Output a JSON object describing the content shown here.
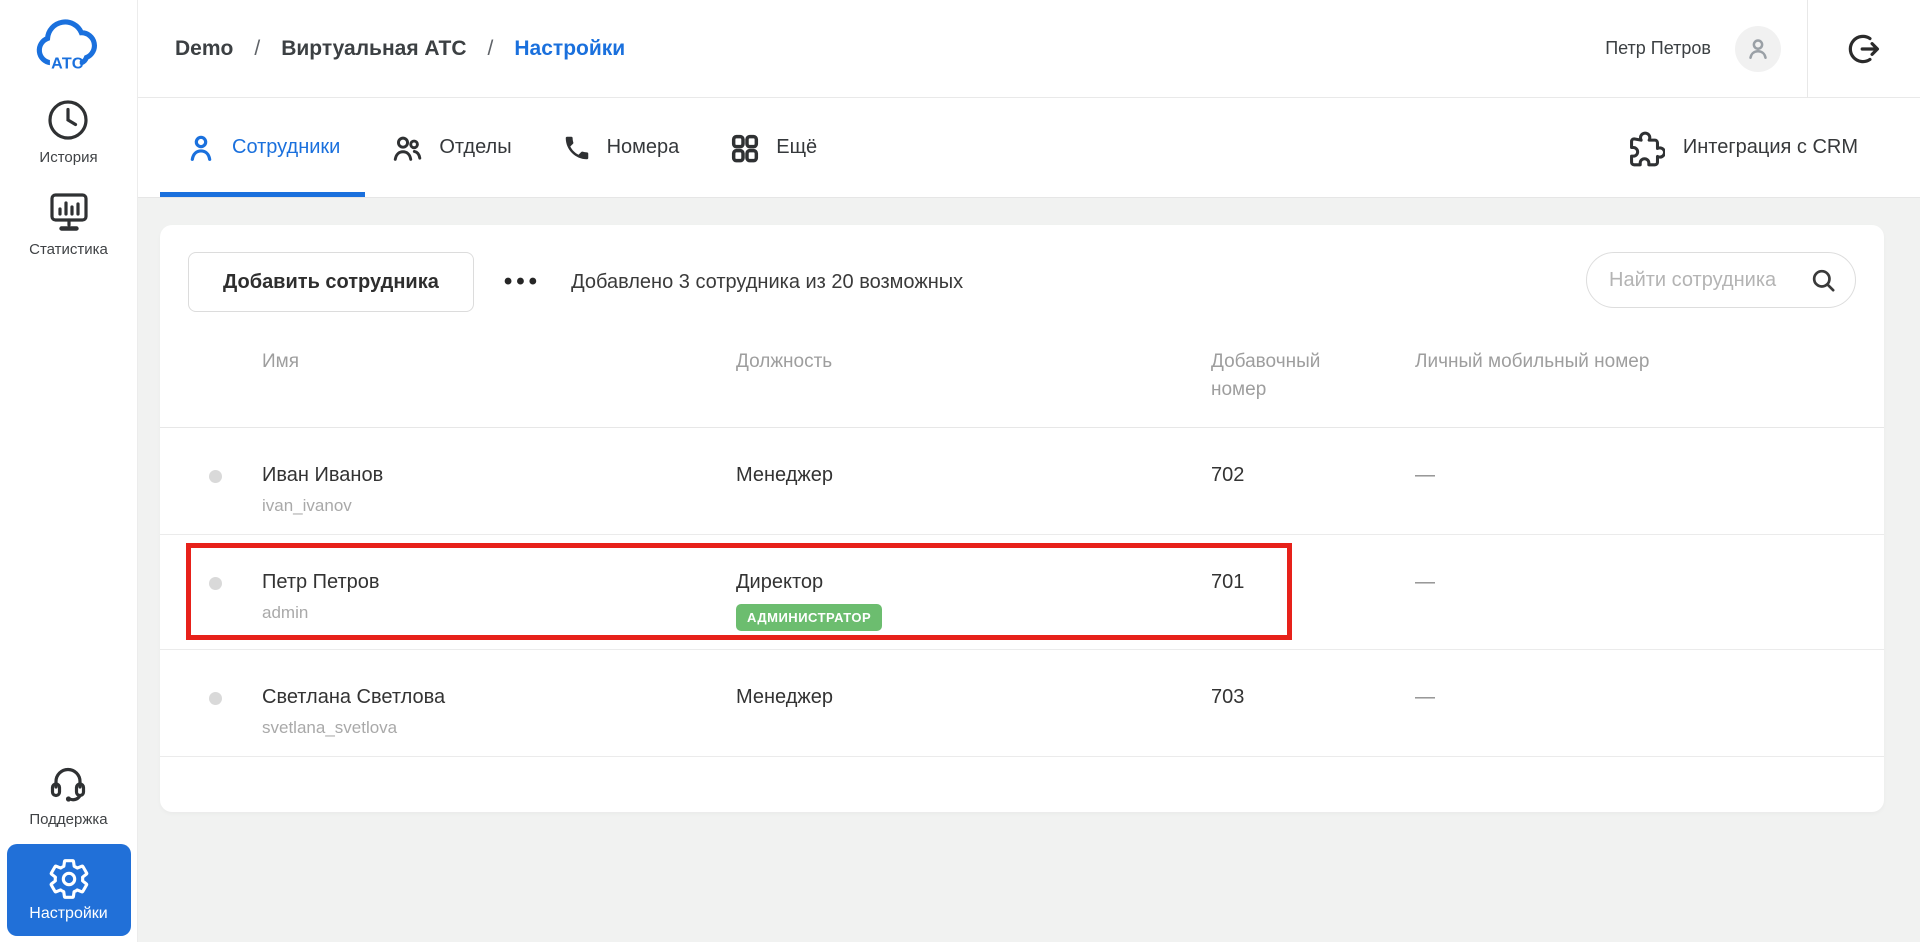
{
  "colors": {
    "accent": "#1a70dd",
    "sidebar_active": "#2170d8",
    "badge_green": "#6cbd6f",
    "highlight_red": "#e7211a"
  },
  "sidebar": {
    "logo_text": "АТС",
    "items": [
      {
        "label": "История"
      },
      {
        "label": "Статистика"
      }
    ],
    "support": {
      "label": "Поддержка"
    },
    "settings": {
      "label": "Настройки"
    }
  },
  "topbar": {
    "breadcrumbs": [
      {
        "label": "Demo"
      },
      {
        "label": "Виртуальная АТС"
      },
      {
        "label": "Настройки"
      }
    ],
    "separator": "/",
    "user_name": "Петр Петров"
  },
  "tabs": {
    "items": [
      {
        "label": "Сотрудники"
      },
      {
        "label": "Отделы"
      },
      {
        "label": "Номера"
      },
      {
        "label": "Ещё"
      }
    ],
    "crm_label": "Интеграция с CRM"
  },
  "toolbar": {
    "add_button": "Добавить сотрудника",
    "more_label": "•••",
    "info": "Добавлено 3 сотрудника из 20 возможных",
    "search_placeholder": "Найти сотрудника"
  },
  "table": {
    "headers": {
      "name": "Имя",
      "role": "Должность",
      "extension": "Добавочный номер",
      "mobile": "Личный мобильный номер"
    },
    "rows": [
      {
        "name": "Иван Иванов",
        "login": "ivan_ivanov",
        "role": "Менеджер",
        "extension": "702",
        "mobile": "—"
      },
      {
        "name": "Петр Петров",
        "login": "admin",
        "role": "Директор",
        "badge": "АДМИНИСТРАТОР",
        "extension": "701",
        "mobile": "—"
      },
      {
        "name": "Светлана Светлова",
        "login": "svetlana_svetlova",
        "role": "Менеджер",
        "extension": "703",
        "mobile": "—"
      }
    ]
  }
}
